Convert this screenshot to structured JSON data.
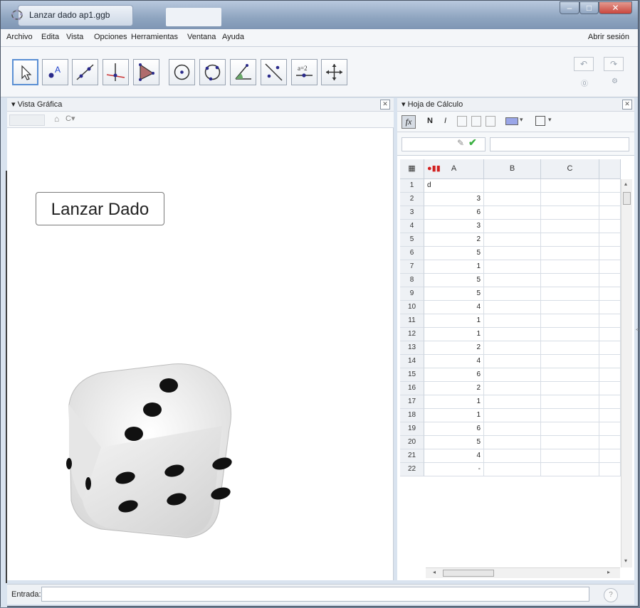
{
  "window": {
    "title": "Lanzar dado ap1.ggb",
    "min_label": "–",
    "max_label": "□",
    "close_label": "✕"
  },
  "menu": {
    "items": [
      "Archivo",
      "Edita",
      "Vista",
      "Opciones",
      "Herramientas",
      "Ventana",
      "Ayuda"
    ],
    "sign_in": "Abrir sesión"
  },
  "toolbar": {
    "tools": [
      "move-tool",
      "point-tool",
      "line-tool",
      "perpendicular-line-tool",
      "polygon-tool",
      "circle-with-center-tool",
      "circle-through-three-points-tool",
      "angle-tool",
      "reflect-about-line-tool",
      "slider-tool",
      "move-graphics-view-tool"
    ],
    "slider_label": "a=2",
    "undo_glyph": "↶",
    "redo_glyph": "↷"
  },
  "graphics_view": {
    "title": "Vista Gráfica",
    "button_label": "Lanzar Dado"
  },
  "spreadsheet": {
    "title": "Hoja de Cálculo",
    "bold": "N",
    "italic": "I",
    "columns": [
      "A",
      "B",
      "C"
    ],
    "rows": [
      {
        "n": "1",
        "a": "d"
      },
      {
        "n": "2",
        "a": "3"
      },
      {
        "n": "3",
        "a": "6"
      },
      {
        "n": "4",
        "a": "3"
      },
      {
        "n": "5",
        "a": "2"
      },
      {
        "n": "6",
        "a": "5"
      },
      {
        "n": "7",
        "a": "1"
      },
      {
        "n": "8",
        "a": "5"
      },
      {
        "n": "9",
        "a": "5"
      },
      {
        "n": "10",
        "a": "4"
      },
      {
        "n": "11",
        "a": "1"
      },
      {
        "n": "12",
        "a": "1"
      },
      {
        "n": "13",
        "a": "2"
      },
      {
        "n": "14",
        "a": "4"
      },
      {
        "n": "15",
        "a": "6"
      },
      {
        "n": "16",
        "a": "2"
      },
      {
        "n": "17",
        "a": "1"
      },
      {
        "n": "18",
        "a": "1"
      },
      {
        "n": "19",
        "a": "6"
      },
      {
        "n": "20",
        "a": "5"
      },
      {
        "n": "21",
        "a": "4"
      },
      {
        "n": "22",
        "a": "-"
      }
    ]
  },
  "input_bar": {
    "label": "Entrada:"
  },
  "colors": {
    "titlebar": "#8fa5c0",
    "close_button": "#c9463d",
    "record_dot": "#d22020",
    "accept_check": "#3cb043"
  }
}
